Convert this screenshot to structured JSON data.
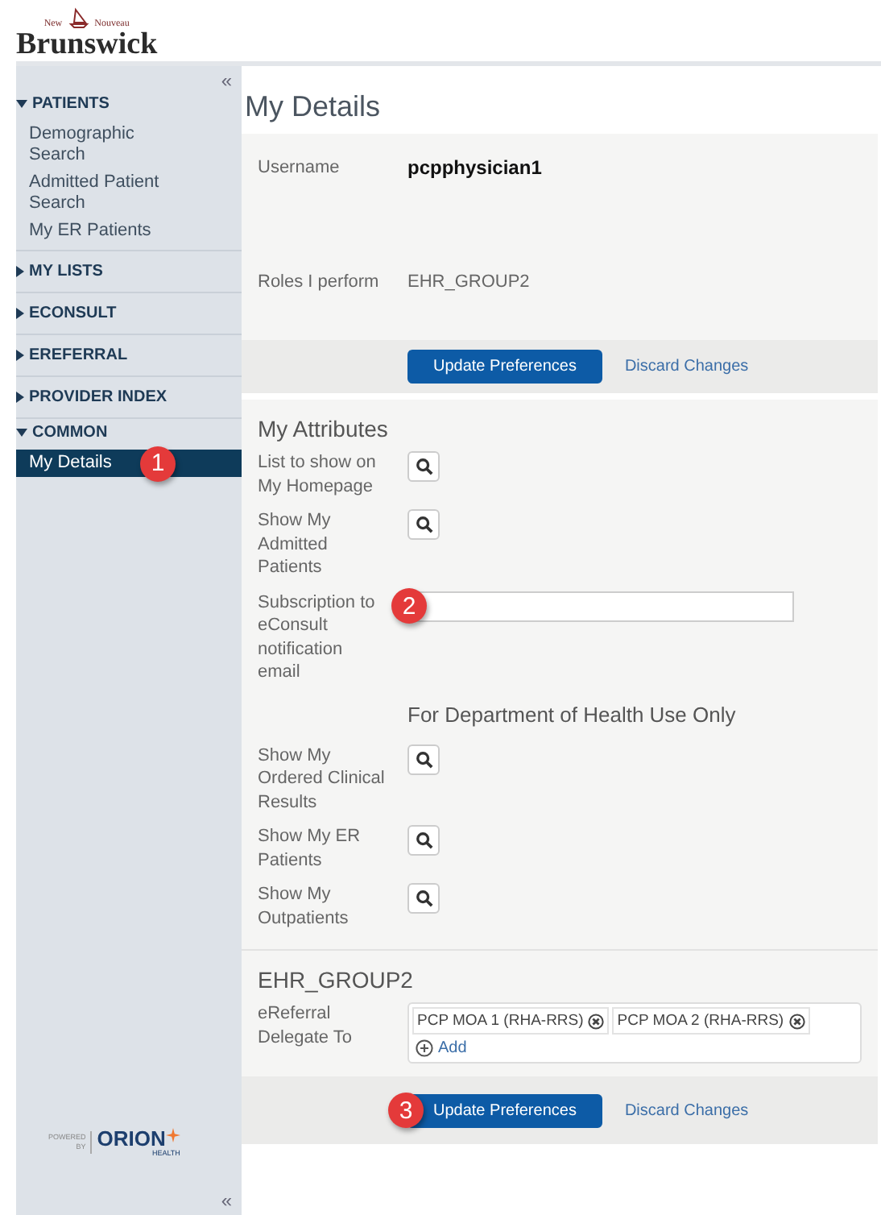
{
  "header": {
    "logo_small_left": "New",
    "logo_small_right": "Nouveau",
    "logo_main": "Brunswick"
  },
  "sidebar": {
    "collapse_top": "«",
    "sections": [
      {
        "title": "PATIENTS",
        "expanded": true,
        "items": [
          {
            "label": "Demographic Search",
            "selected": false
          },
          {
            "label": "Admitted Patient Search",
            "selected": false
          },
          {
            "label": "My ER Patients",
            "selected": false
          }
        ]
      },
      {
        "title": "MY LISTS",
        "expanded": false
      },
      {
        "title": "ECONSULT",
        "expanded": false
      },
      {
        "title": "EREFERRAL",
        "expanded": false
      },
      {
        "title": "PROVIDER INDEX",
        "expanded": false
      },
      {
        "title": "COMMON",
        "expanded": true,
        "items": [
          {
            "label": "My Details",
            "selected": true
          }
        ]
      }
    ],
    "powered": {
      "line1": "POWERED",
      "line2": "BY",
      "brand": "ORION",
      "sub": "HEALTH"
    },
    "collapse_bottom": "«"
  },
  "main": {
    "title": "My Details",
    "account": {
      "username_label": "Username",
      "username": "pcpphysician1",
      "roles_label": "Roles I perform",
      "roles": "EHR_GROUP2"
    },
    "actions": {
      "update": "Update Preferences",
      "discard": "Discard Changes"
    },
    "attributes": {
      "title": "My Attributes",
      "rows": [
        {
          "kind": "lookup",
          "label": "List to show on My Homepage"
        },
        {
          "kind": "lookup",
          "label": "Show My Admitted Patients"
        },
        {
          "kind": "text",
          "label": "Subscription to eConsult notification email"
        },
        {
          "kind": "heading",
          "label": "For Department of Health Use Only"
        },
        {
          "kind": "lookup",
          "label": "Show My Ordered Clinical Results"
        },
        {
          "kind": "lookup",
          "label": "Show My ER Patients"
        },
        {
          "kind": "lookup",
          "label": "Show My Outpatients"
        }
      ]
    },
    "group": {
      "title": "EHR_GROUP2",
      "label": "eReferral Delegate To",
      "delegates": [
        "PCP MOA 1 (RHA-RRS)",
        "PCP MOA 2 (RHA-RRS)"
      ],
      "add": "Add"
    },
    "bottom_actions": {
      "update": "Update Preferences",
      "discard": "Discard Changes"
    }
  },
  "callouts": [
    {
      "number": "1"
    },
    {
      "number": "2"
    },
    {
      "number": "3"
    }
  ]
}
